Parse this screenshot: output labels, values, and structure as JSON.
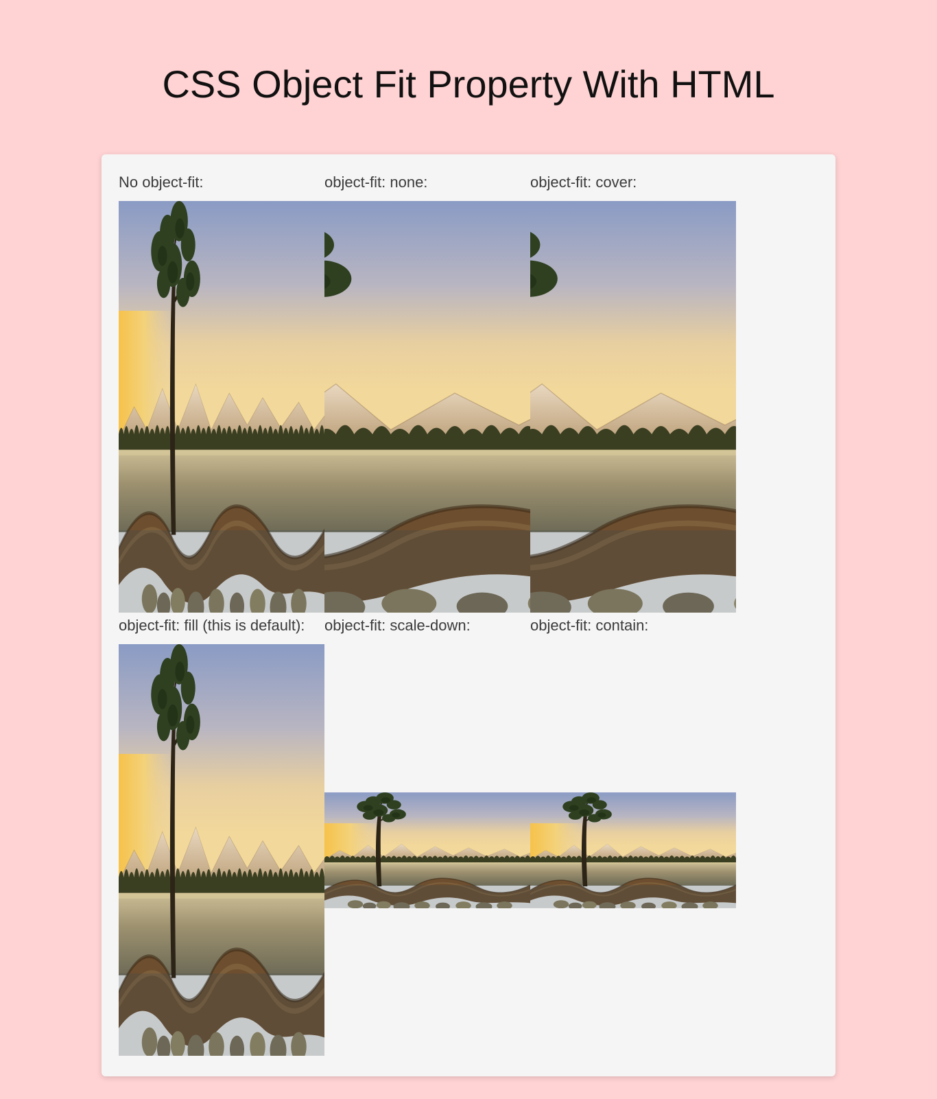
{
  "title": "CSS Object Fit Property With HTML",
  "labels": {
    "nofit": "No object-fit:",
    "none": "object-fit: none:",
    "cover": "object-fit: cover:",
    "fill": "object-fit: fill (this is default):",
    "scaledown": "object-fit: scale-down:",
    "contain": "object-fit: contain:"
  }
}
